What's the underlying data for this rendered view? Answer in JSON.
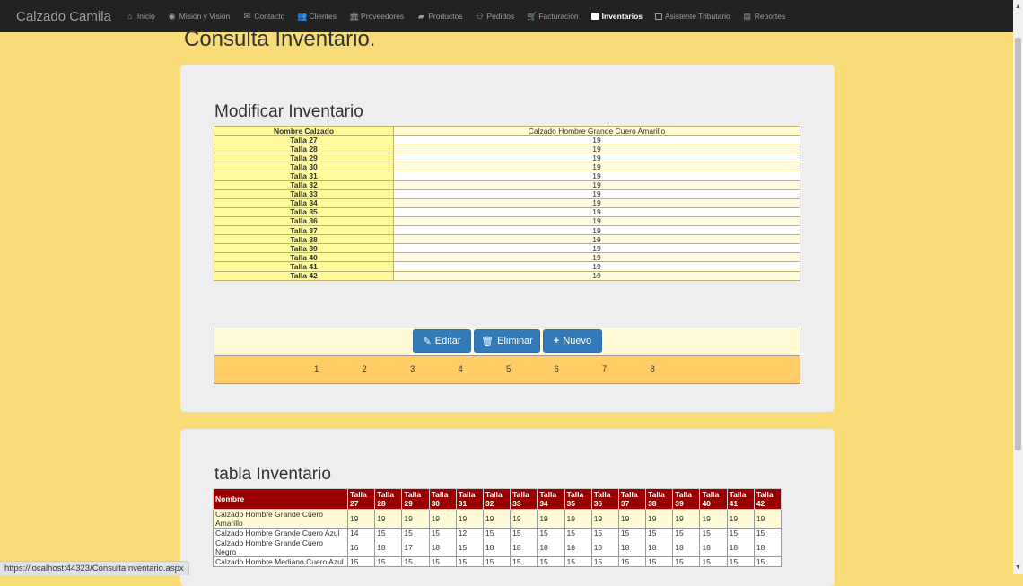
{
  "navbar": {
    "brand": "Calzado Camila",
    "items": [
      {
        "label": "Inicio",
        "icon": "home-icon",
        "glyph": "⌂"
      },
      {
        "label": "Misión y Visión",
        "icon": "eye-icon",
        "glyph": "◉"
      },
      {
        "label": "Contacto",
        "icon": "envelope-icon",
        "glyph": "✉"
      },
      {
        "label": "Clientes",
        "icon": "users-icon",
        "glyph": "👥"
      },
      {
        "label": "Proveedores",
        "icon": "institution-icon",
        "glyph": "🏛"
      },
      {
        "label": "Productos",
        "icon": "book-icon",
        "glyph": "▰"
      },
      {
        "label": "Pedidos",
        "icon": "handshake-icon",
        "glyph": "⚇"
      },
      {
        "label": "Facturación",
        "icon": "cart-icon",
        "glyph": "🛒"
      },
      {
        "label": "Inventarios",
        "icon": "inventory-icon",
        "glyph": ""
      },
      {
        "label": "Asistente Tributario",
        "icon": "calendar-icon",
        "glyph": ""
      },
      {
        "label": "Reportes",
        "icon": "file-icon",
        "glyph": "▤"
      }
    ]
  },
  "page_title": "Consulta Inventario.",
  "detail_section": {
    "title": "Modificar Inventario",
    "name_label": "Nombre Calzado",
    "name_value": "Calzado Hombre Grande Cuero Amarillo",
    "rows": [
      {
        "label": "Talla 27",
        "value": "19"
      },
      {
        "label": "Talla 28",
        "value": "19"
      },
      {
        "label": "Talla 29",
        "value": "19"
      },
      {
        "label": "Talla 30",
        "value": "19"
      },
      {
        "label": "Talla 31",
        "value": "19"
      },
      {
        "label": "Talla 32",
        "value": "19"
      },
      {
        "label": "Talla 33",
        "value": "19"
      },
      {
        "label": "Talla 34",
        "value": "19"
      },
      {
        "label": "Talla 35",
        "value": "19"
      },
      {
        "label": "Talla 36",
        "value": "19"
      },
      {
        "label": "Talla 37",
        "value": "19"
      },
      {
        "label": "Talla 38",
        "value": "19"
      },
      {
        "label": "Talla 39",
        "value": "19"
      },
      {
        "label": "Talla 40",
        "value": "19"
      },
      {
        "label": "Talla 41",
        "value": "19"
      },
      {
        "label": "Talla 42",
        "value": "19"
      }
    ],
    "buttons": {
      "edit": "Editar",
      "delete": "Eliminar",
      "new": "Nuevo"
    },
    "pages": [
      "1",
      "2",
      "3",
      "4",
      "5",
      "6",
      "7",
      "8"
    ]
  },
  "grid_section": {
    "title": "tabla Inventario",
    "headers": [
      "Nombre",
      "Talla 27",
      "Talla 28",
      "Talla 29",
      "Talla 30",
      "Talla 31",
      "Talla 32",
      "Talla 33",
      "Talla 34",
      "Talla 35",
      "Talla 36",
      "Talla 37",
      "Talla 38",
      "Talla 39",
      "Talla 40",
      "Talla 41",
      "Talla 42"
    ],
    "rows": [
      [
        "Calzado Hombre Grande Cuero Amarillo",
        "19",
        "19",
        "19",
        "19",
        "19",
        "19",
        "19",
        "19",
        "19",
        "19",
        "19",
        "19",
        "19",
        "19",
        "19",
        "19"
      ],
      [
        "Calzado Hombre Grande Cuero Azul",
        "14",
        "15",
        "15",
        "15",
        "12",
        "15",
        "15",
        "15",
        "15",
        "15",
        "15",
        "15",
        "15",
        "15",
        "15",
        "15"
      ],
      [
        "Calzado Hombre Grande Cuero Negro",
        "16",
        "18",
        "17",
        "18",
        "15",
        "18",
        "18",
        "18",
        "18",
        "18",
        "18",
        "18",
        "18",
        "18",
        "18",
        "18"
      ],
      [
        "Calzado Hombre Mediano Cuero Azul",
        "15",
        "15",
        "15",
        "15",
        "15",
        "15",
        "15",
        "15",
        "15",
        "15",
        "15",
        "15",
        "15",
        "15",
        "15",
        "15"
      ]
    ]
  },
  "status_url": "https://localhost:44323/ConsultaInventario.aspx",
  "colors": {
    "background": "#f8dc78",
    "navbar": "#222222",
    "grid_header": "#990000",
    "pager": "#ffcc66",
    "button": "#337ab7"
  }
}
